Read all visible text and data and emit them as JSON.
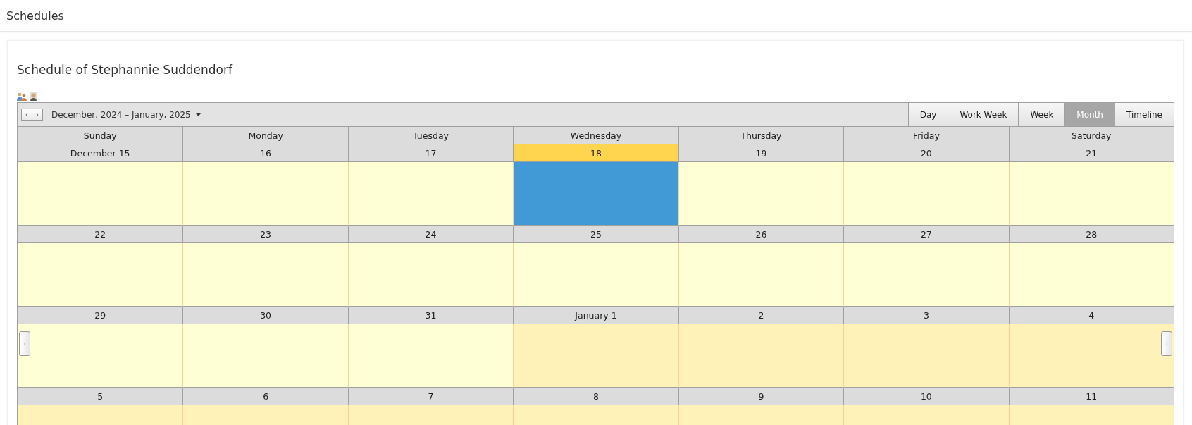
{
  "header": {
    "title": "Schedules"
  },
  "card": {
    "title": "Schedule of Stephannie Suddendorf"
  },
  "toolbar": {
    "prev": "‹",
    "next": "›",
    "range": "December, 2024 – January, 2025",
    "views": [
      {
        "label": "Day",
        "selected": false
      },
      {
        "label": "Work Week",
        "selected": false
      },
      {
        "label": "Week",
        "selected": false
      },
      {
        "label": "Month",
        "selected": true
      },
      {
        "label": "Timeline",
        "selected": false
      }
    ]
  },
  "weekdays": [
    "Sunday",
    "Monday",
    "Tuesday",
    "Wednesday",
    "Thursday",
    "Friday",
    "Saturday"
  ],
  "weeks": [
    {
      "dates": [
        {
          "label": "December 15",
          "today": false
        },
        {
          "label": "16",
          "today": false
        },
        {
          "label": "17",
          "today": false
        },
        {
          "label": "18",
          "today": true
        },
        {
          "label": "19",
          "today": false
        },
        {
          "label": "20",
          "today": false
        },
        {
          "label": "21",
          "today": false
        }
      ],
      "cells": [
        {
          "other_month": false,
          "selected": false
        },
        {
          "other_month": false,
          "selected": false
        },
        {
          "other_month": false,
          "selected": false
        },
        {
          "other_month": false,
          "selected": true
        },
        {
          "other_month": false,
          "selected": false
        },
        {
          "other_month": false,
          "selected": false
        },
        {
          "other_month": false,
          "selected": false
        }
      ]
    },
    {
      "dates": [
        {
          "label": "22",
          "today": false
        },
        {
          "label": "23",
          "today": false
        },
        {
          "label": "24",
          "today": false
        },
        {
          "label": "25",
          "today": false
        },
        {
          "label": "26",
          "today": false
        },
        {
          "label": "27",
          "today": false
        },
        {
          "label": "28",
          "today": false
        }
      ],
      "cells": [
        {
          "other_month": false,
          "selected": false
        },
        {
          "other_month": false,
          "selected": false
        },
        {
          "other_month": false,
          "selected": false
        },
        {
          "other_month": false,
          "selected": false
        },
        {
          "other_month": false,
          "selected": false
        },
        {
          "other_month": false,
          "selected": false
        },
        {
          "other_month": false,
          "selected": false
        }
      ]
    },
    {
      "dates": [
        {
          "label": "29",
          "today": false
        },
        {
          "label": "30",
          "today": false
        },
        {
          "label": "31",
          "today": false
        },
        {
          "label": "January 1",
          "today": false
        },
        {
          "label": "2",
          "today": false
        },
        {
          "label": "3",
          "today": false
        },
        {
          "label": "4",
          "today": false
        }
      ],
      "cells": [
        {
          "other_month": false,
          "selected": false
        },
        {
          "other_month": false,
          "selected": false
        },
        {
          "other_month": false,
          "selected": false
        },
        {
          "other_month": true,
          "selected": false
        },
        {
          "other_month": true,
          "selected": false
        },
        {
          "other_month": true,
          "selected": false
        },
        {
          "other_month": true,
          "selected": false
        }
      ]
    },
    {
      "dates": [
        {
          "label": "5",
          "today": false
        },
        {
          "label": "6",
          "today": false
        },
        {
          "label": "7",
          "today": false
        },
        {
          "label": "8",
          "today": false
        },
        {
          "label": "9",
          "today": false
        },
        {
          "label": "10",
          "today": false
        },
        {
          "label": "11",
          "today": false
        }
      ],
      "cells": [
        {
          "other_month": true,
          "selected": false
        },
        {
          "other_month": true,
          "selected": false
        },
        {
          "other_month": true,
          "selected": false
        },
        {
          "other_month": true,
          "selected": false
        },
        {
          "other_month": true,
          "selected": false
        },
        {
          "other_month": true,
          "selected": false
        },
        {
          "other_month": true,
          "selected": false
        }
      ]
    }
  ],
  "side_buttons": {
    "prev": "‹",
    "next": "›"
  }
}
